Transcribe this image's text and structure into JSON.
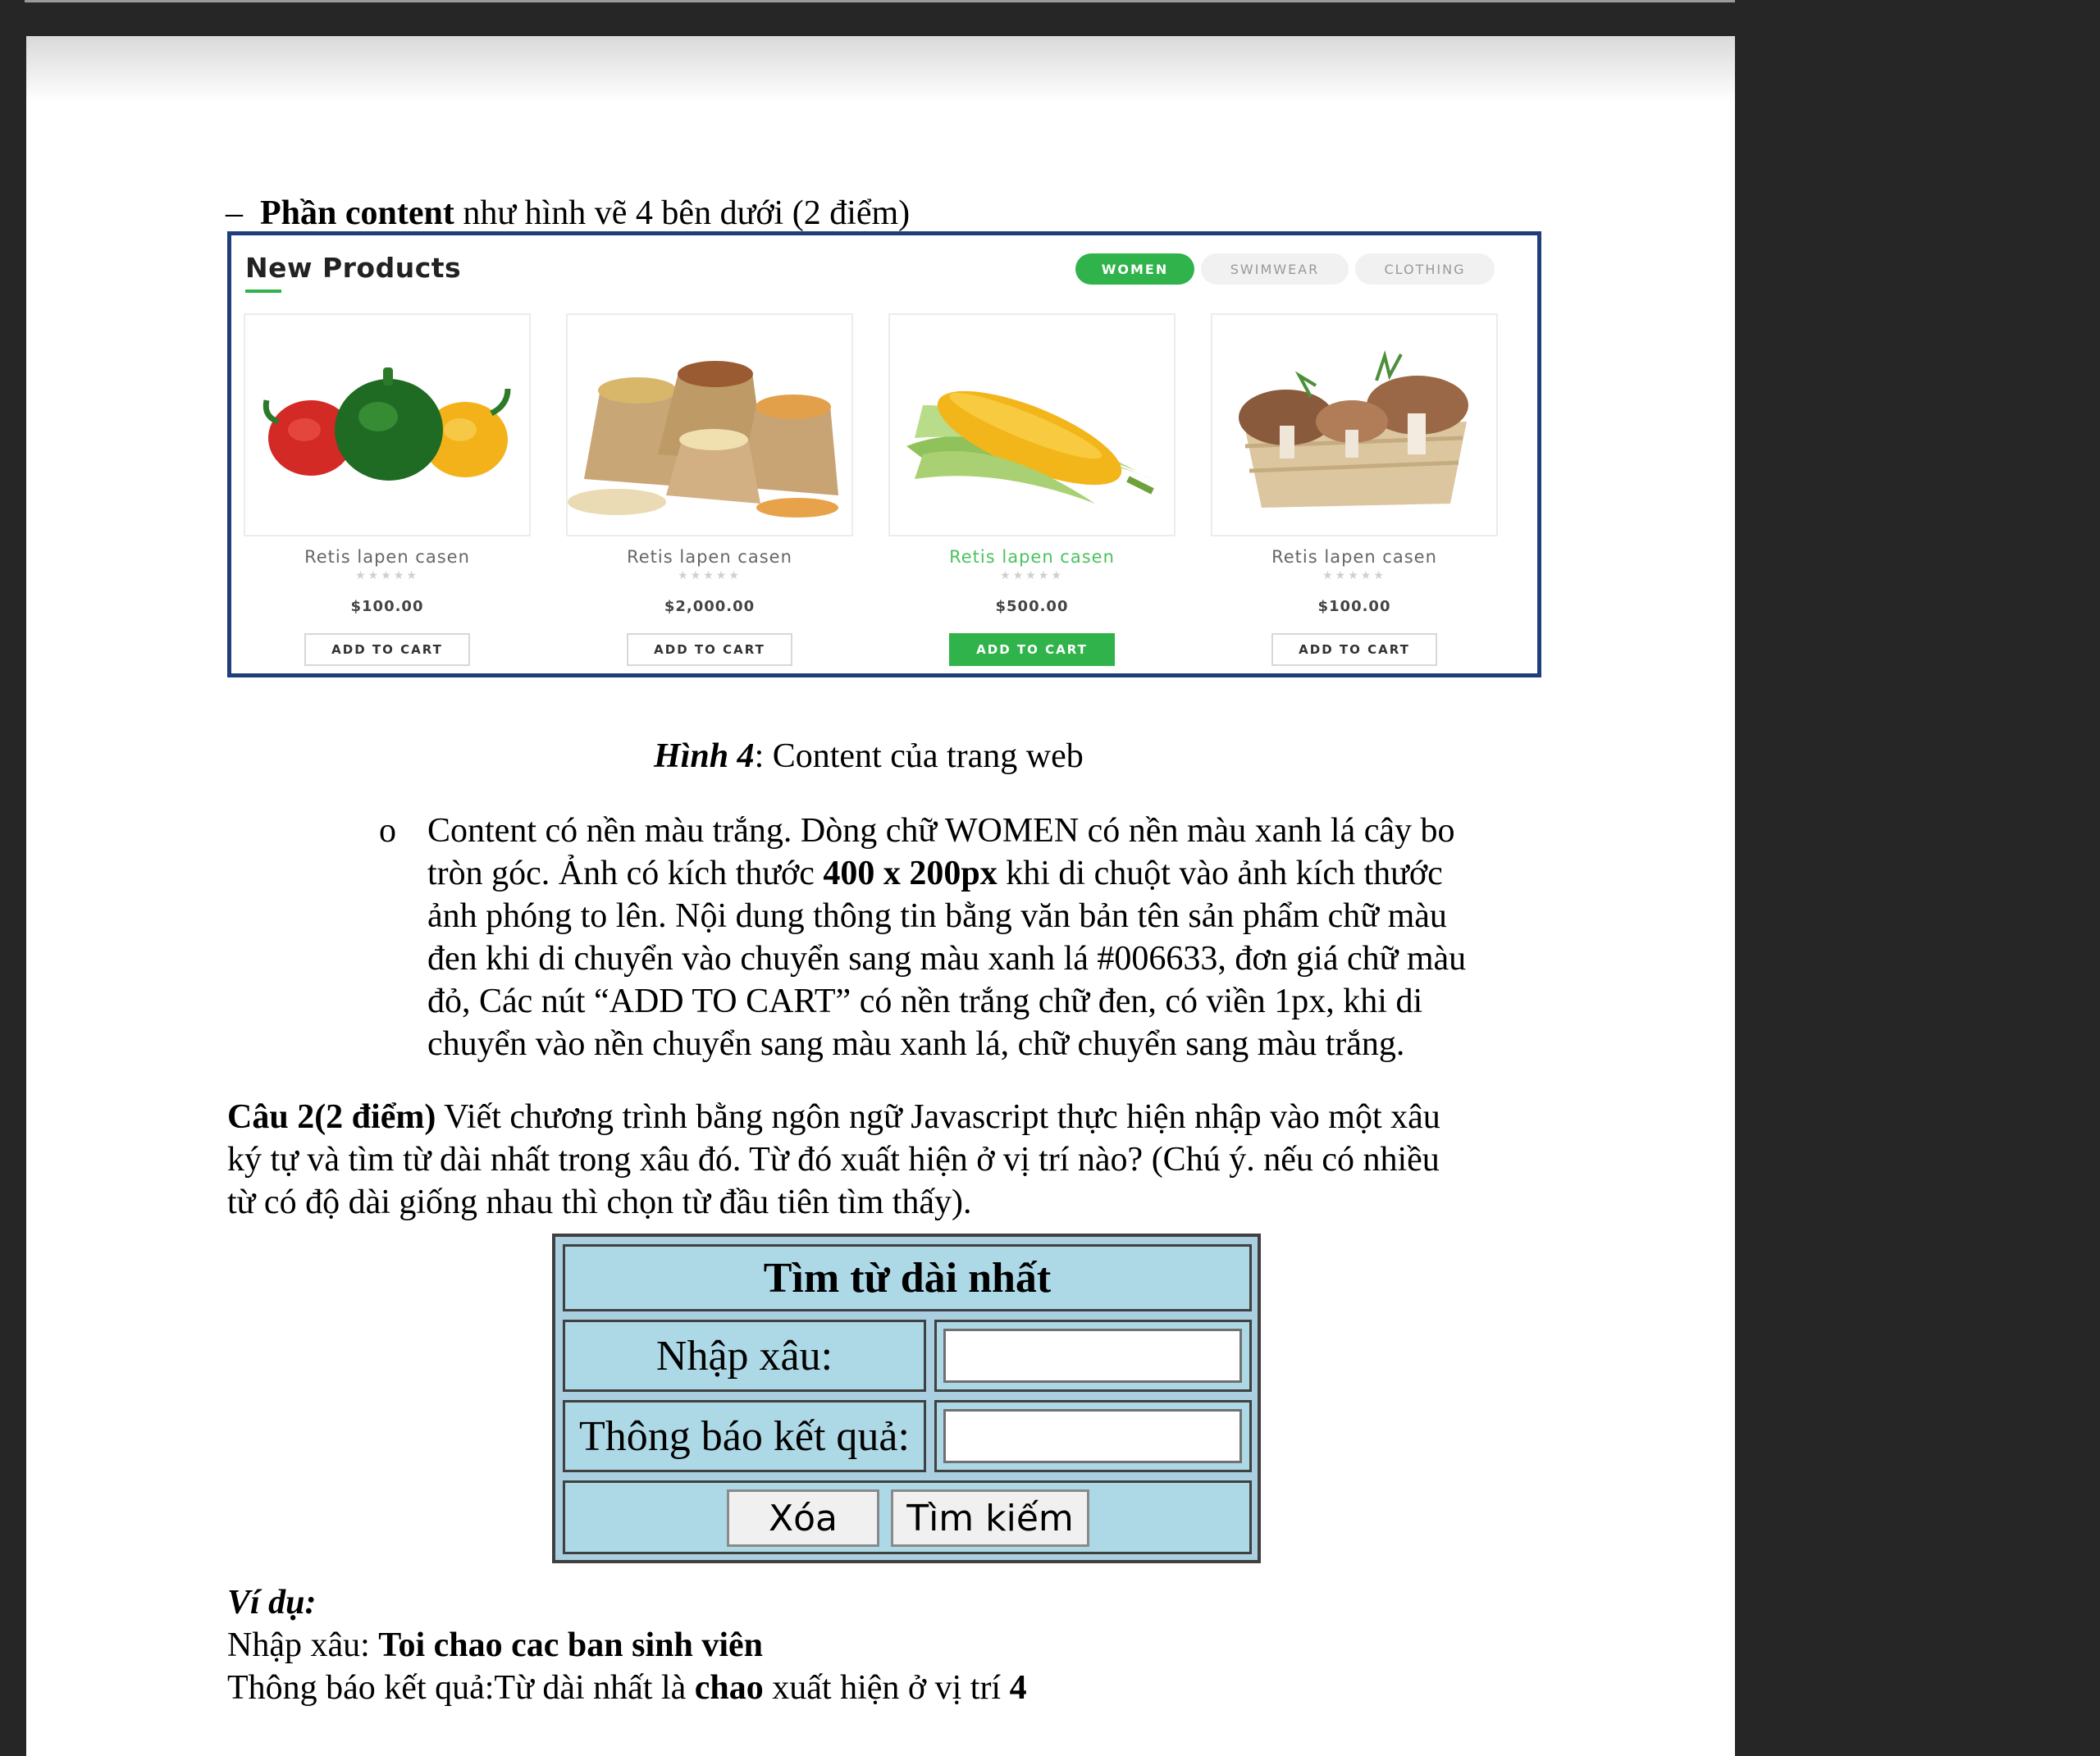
{
  "section": {
    "dash": "–",
    "bold": "Phần content",
    "rest": " như hình vẽ 4 bên dưới (2 điểm)"
  },
  "figure4": {
    "title": "New Products",
    "tabs": [
      "WOMEN",
      "SWIMWEAR",
      "CLOTHING"
    ],
    "products": [
      {
        "image": "bell-peppers-image",
        "name": "Retis lapen casen",
        "stars": "★★★★★",
        "price": "$100.00",
        "button": "ADD TO CART"
      },
      {
        "image": "nuts-sacks-image",
        "name": "Retis lapen casen",
        "stars": "★★★★★",
        "price": "$2,000.00",
        "button": "ADD TO CART"
      },
      {
        "image": "corn-image",
        "name": "Retis lapen casen",
        "stars": "★★★★★",
        "price": "$500.00",
        "button": "ADD TO CART"
      },
      {
        "image": "mushrooms-basket-image",
        "name": "Retis lapen casen",
        "stars": "★★★★★",
        "price": "$100.00",
        "button": "ADD TO CART"
      }
    ],
    "accent_color": "#2fb34a",
    "border_color": "#1f3f7a"
  },
  "caption4": {
    "label": "Hình 4",
    "text": ": Content của trang web"
  },
  "bullet": {
    "marker": "o",
    "line1": "Content có nền màu trắng. Dòng chữ WOMEN có nền màu xanh lá cây  bo",
    "line2_a": "tròn góc. Ảnh có kích thước ",
    "line2_b": "400 x 200px",
    "line2_c": " khi di chuột vào ảnh kích thước",
    "line3": "ảnh phóng to lên. Nội dung thông tin bằng văn bản tên sản phẩm chữ màu",
    "line4": "đen khi di chuyển vào chuyển sang màu xanh lá #006633, đơn giá chữ màu",
    "line5": "đỏ, Các nút “ADD TO CART” có nền trắng chữ đen, có viền 1px, khi di",
    "line6": "chuyển vào nền chuyển sang màu xanh lá, chữ chuyển sang màu trắng."
  },
  "question2": {
    "bold": "Câu 2(2 điểm)",
    "line1": " Viết chương trình bằng ngôn ngữ Javascript thực hiện nhập vào một xâu",
    "line2": "ký tự và tìm từ dài nhất trong xâu đó. Từ đó xuất hiện ở vị trí nào? (Chú ý. nếu có nhiều",
    "line3": "từ có độ dài giống nhau thì chọn từ đầu tiên tìm thấy)."
  },
  "form": {
    "title": "Tìm từ dài nhất",
    "input_label": "Nhập xâu:",
    "input_value": "",
    "result_label": "Thông báo kết quả:",
    "result_value": "",
    "clear_button": "Xóa",
    "search_button": "Tìm kiếm"
  },
  "example": {
    "heading": "Ví dụ:",
    "input_prefix": "Nhập xâu: ",
    "input_value": "Toi chao cac ban sinh viên",
    "result_prefix": "Thông báo kết quả:Từ dài nhất là ",
    "result_word": "chao",
    "result_mid": " xuất hiện ở vị trí ",
    "result_pos": "4"
  }
}
